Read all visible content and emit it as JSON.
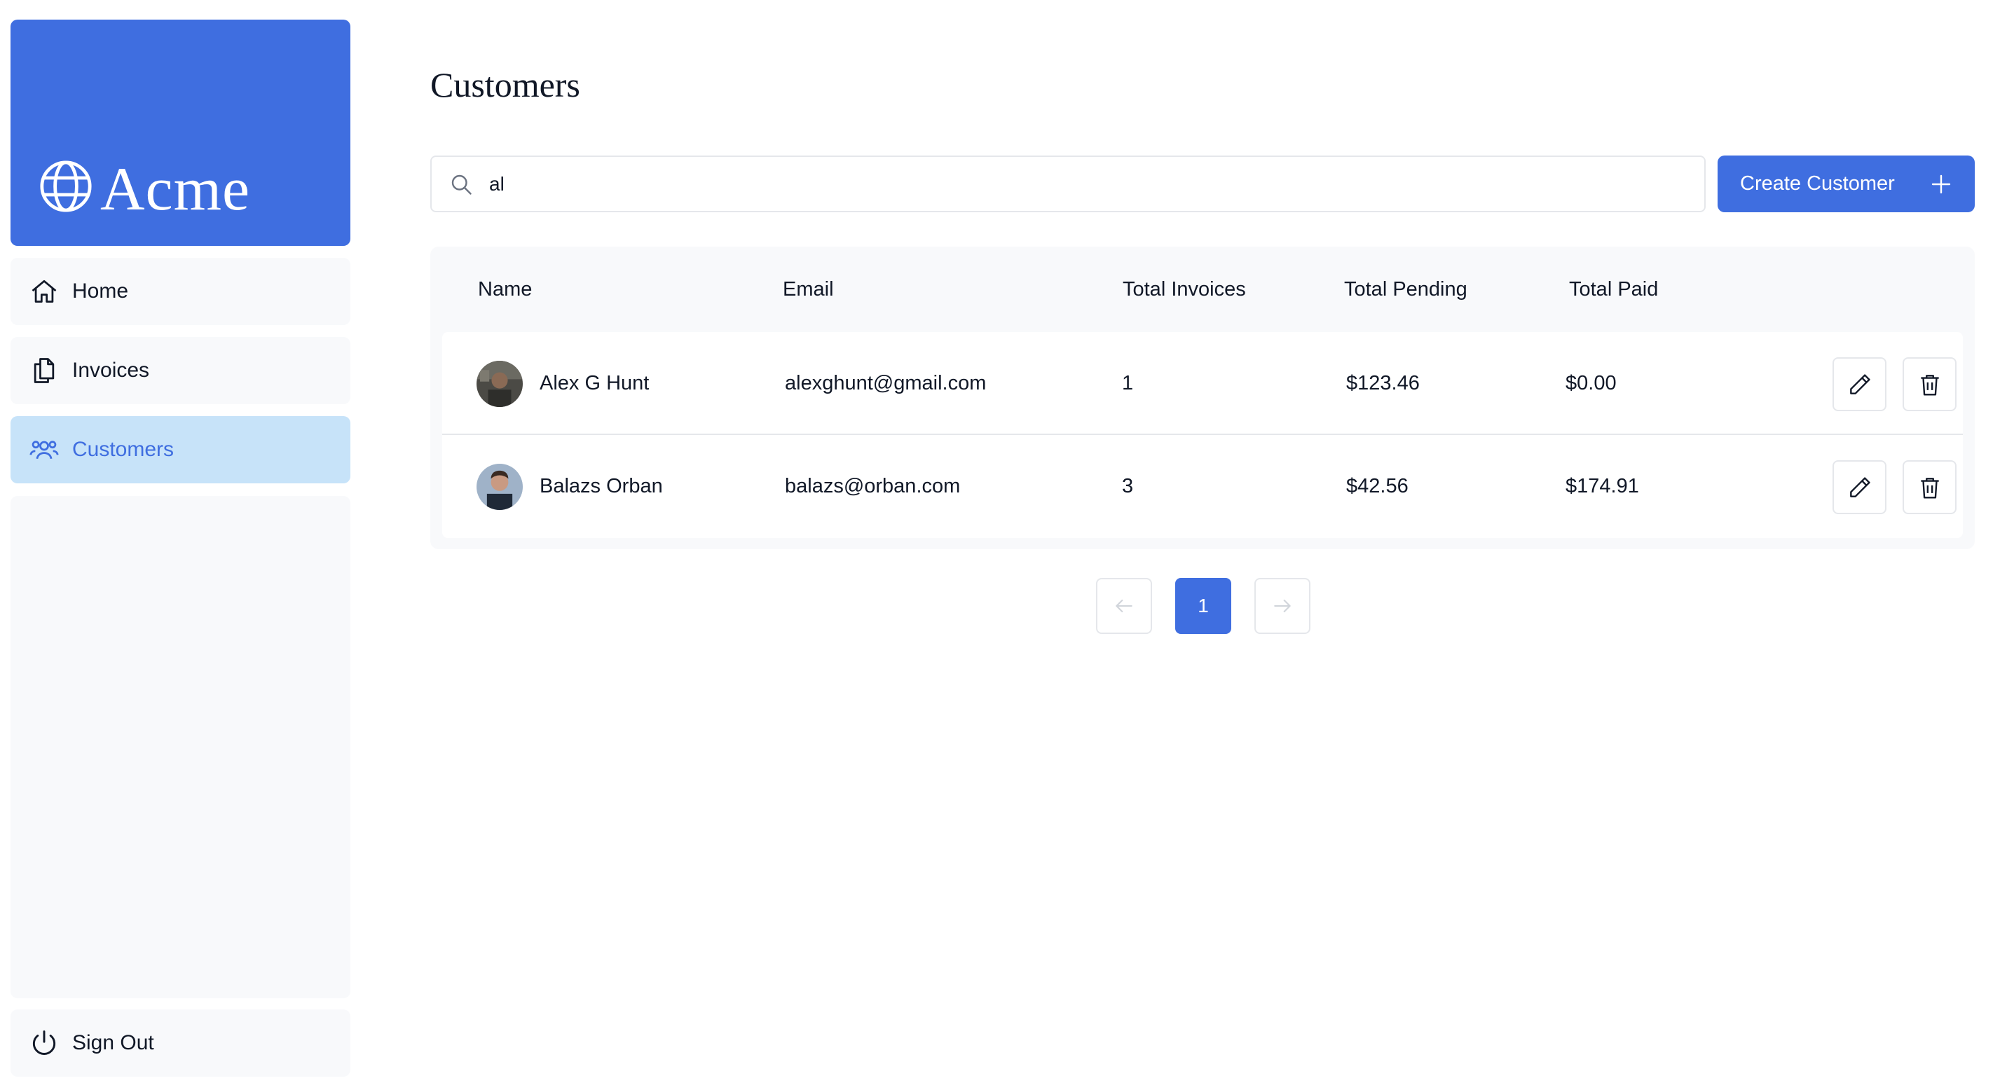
{
  "app": {
    "logo_text": "Acme"
  },
  "sidebar": {
    "items": [
      {
        "label": "Home",
        "icon": "home-icon"
      },
      {
        "label": "Invoices",
        "icon": "documents-icon"
      },
      {
        "label": "Customers",
        "icon": "users-icon",
        "active": true
      }
    ],
    "sign_out_label": "Sign Out"
  },
  "main": {
    "title": "Customers",
    "search": {
      "value": "al",
      "icon": "search-icon"
    },
    "create_button": {
      "label": "Create Customer",
      "icon": "plus-icon"
    },
    "table": {
      "headers": [
        "Name",
        "Email",
        "Total Invoices",
        "Total Pending",
        "Total Paid"
      ],
      "rows": [
        {
          "name": "Alex G Hunt",
          "email": "alexghunt@gmail.com",
          "total_invoices": "1",
          "total_pending": "$123.46",
          "total_paid": "$0.00"
        },
        {
          "name": "Balazs Orban",
          "email": "balazs@orban.com",
          "total_invoices": "3",
          "total_pending": "$42.56",
          "total_paid": "$174.91"
        }
      ]
    },
    "pagination": {
      "current_page": "1"
    }
  },
  "colors": {
    "primary": "#3f6ee0",
    "active_nav_bg": "#c7e3f9",
    "panel_bg": "#f8f9fb"
  }
}
